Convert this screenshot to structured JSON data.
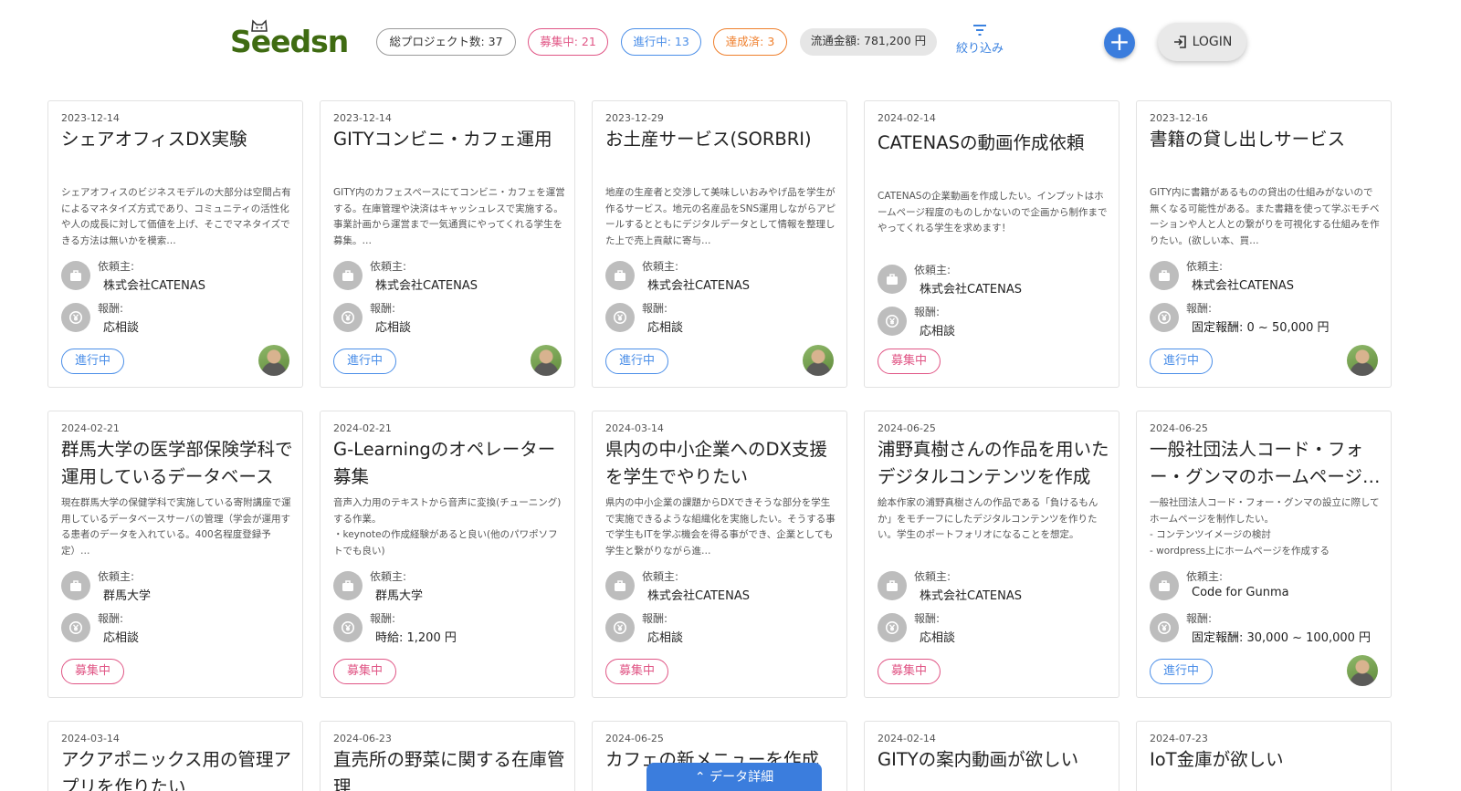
{
  "header": {
    "logo": "Seedsn",
    "stats": {
      "total": "総プロジェクト数: 37",
      "recruiting": "募集中: 21",
      "in_progress": "進行中: 13",
      "completed": "達成済: 3",
      "money": "流通金額: 781,200 円"
    },
    "filter_label": "絞り込み",
    "add_label": "+",
    "login_label": "LOGIN"
  },
  "labels": {
    "client": "依頼主:",
    "reward": "報酬:"
  },
  "colors": {
    "brand": "#3f6b12",
    "accent": "#3b7ddd",
    "recruiting": "#e05585",
    "in_progress": "#4a8ee8",
    "completed": "#ef7f2c"
  },
  "cards": [
    {
      "date": "2023-12-14",
      "title": "シェアオフィスDX実験",
      "desc": "シェアオフィスのビジネスモデルの大部分は空間占有によるマネタイズ方式であり、コミュニティの活性化や人の成長に対して価値を上げ、そこでマネタイズできる方法は無いかを模索…",
      "client": "株式会社CATENAS",
      "reward": "応相談",
      "status": "進行中",
      "status_type": "progress",
      "avatar": true
    },
    {
      "date": "2023-12-14",
      "title": "GITYコンビニ・カフェ運用",
      "desc": "GITY内のカフェスペースにてコンビニ・カフェを運営する。在庫管理や決済はキャッシュレスで実施する。事業計画から運営まで一気通貫にやってくれる学生を募集。…",
      "client": "株式会社CATENAS",
      "reward": "応相談",
      "status": "進行中",
      "status_type": "progress",
      "avatar": true
    },
    {
      "date": "2023-12-29",
      "title": "お土産サービス(SORBRI)",
      "desc": "地産の生産者と交渉して美味しいおみやげ品を学生が作るサービス。地元の名産品をSNS運用しながらアピールするとともにデジタルデータとして情報を整理した上で売上貢献に寄与…",
      "client": "株式会社CATENAS",
      "reward": "応相談",
      "status": "進行中",
      "status_type": "progress",
      "avatar": true
    },
    {
      "date": "2024-02-14",
      "title": "CATENASの動画作成依頼",
      "desc": "CATENASの企業動画を作成したい。インプットはホームページ程度のものしかないので企画から制作までやってくれる学生を求めます！",
      "client": "株式会社CATENAS",
      "reward": "応相談",
      "status": "募集中",
      "status_type": "recruit",
      "avatar": false
    },
    {
      "date": "2023-12-16",
      "title": "書籍の貸し出しサービス",
      "desc": "GITY内に書籍があるものの貸出の仕組みがないので無くなる可能性がある。また書籍を使って学ぶモチベーションや人と人との繋がりを可視化する仕組みを作りたい。(欲しい本、買…",
      "client": "株式会社CATENAS",
      "reward": "固定報酬:  0 ~ 50,000 円",
      "status": "進行中",
      "status_type": "progress",
      "avatar": true
    },
    {
      "date": "2024-02-21",
      "title": "群馬大学の医学部保険学科で運用しているデータベース",
      "desc": "現在群馬大学の保健学科で実施している寄附講座で運用しているデータベースサーバの管理（学会が運用する患者のデータを入れている。400名程度登録予定）…",
      "client": "群馬大学",
      "reward": "応相談",
      "status": "募集中",
      "status_type": "recruit",
      "avatar": false
    },
    {
      "date": "2024-02-21",
      "title": "G-Learningのオペレーター募集",
      "desc": "音声入力用のテキストから音声に変換(チューニング)する作業。\n・keynoteの作成経験があると良い(他のパワポソフトでも良い)",
      "client": "群馬大学",
      "reward": "時給:  1,200 円",
      "status": "募集中",
      "status_type": "recruit",
      "avatar": false
    },
    {
      "date": "2024-03-14",
      "title": "県内の中小企業へのDX支援を学生でやりたい",
      "desc": "県内の中小企業の課題からDXできそうな部分を学生で実施できるような組織化を実施したい。そうする事で学生もITを学ぶ機会を得る事ができ、企業としても学生と繋がりながら進…",
      "client": "株式会社CATENAS",
      "reward": "応相談",
      "status": "募集中",
      "status_type": "recruit",
      "avatar": false
    },
    {
      "date": "2024-06-25",
      "title": "浦野真樹さんの作品を用いたデジタルコンテンツを作成",
      "desc": "絵本作家の浦野真樹さんの作品である「負けるもんか」をモチーフにしたデジタルコンテンツを作りたい。学生のポートフォリオになることを想定。",
      "client": "株式会社CATENAS",
      "reward": "応相談",
      "status": "募集中",
      "status_type": "recruit",
      "avatar": false
    },
    {
      "date": "2024-06-25",
      "title": "一般社団法人コード・フォー・グンマのホームページ作成",
      "desc": "一般社団法人コード・フォー・グンマの設立に際してホームページを制作したい。\n- コンテンツイメージの検討\n- wordpress上にホームページを作成する",
      "client": "Code for Gunma",
      "reward": "固定報酬:  30,000 ~ 100,000 円",
      "status": "進行中",
      "status_type": "progress",
      "avatar": true
    },
    {
      "date": "2024-03-14",
      "title": "アクアポニックス用の管理アプリを作りたい",
      "desc": "",
      "client": "",
      "reward": "",
      "status": "",
      "status_type": "",
      "avatar": false
    },
    {
      "date": "2024-06-23",
      "title": "直売所の野菜に関する在庫管理",
      "desc": "",
      "client": "",
      "reward": "",
      "status": "",
      "status_type": "",
      "avatar": false
    },
    {
      "date": "2024-06-25",
      "title": "カフェの新メニューを作成",
      "desc": "",
      "client": "",
      "reward": "",
      "status": "",
      "status_type": "",
      "avatar": false
    },
    {
      "date": "2024-02-14",
      "title": "GITYの案内動画が欲しい",
      "desc": "",
      "client": "",
      "reward": "",
      "status": "",
      "status_type": "",
      "avatar": false
    },
    {
      "date": "2024-07-23",
      "title": "IoT金庫が欲しい",
      "desc": "",
      "client": "",
      "reward": "",
      "status": "",
      "status_type": "",
      "avatar": false
    }
  ],
  "footer": {
    "data_detail_label": "データ詳細"
  }
}
